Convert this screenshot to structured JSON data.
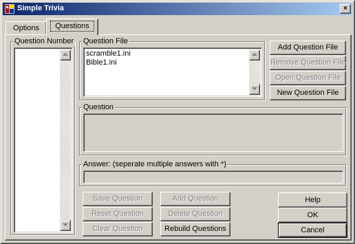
{
  "window": {
    "title": "Simple Trivia",
    "icon": "trivia-app-icon",
    "close_label": "×"
  },
  "tabs": [
    {
      "label": "Options",
      "selected": false
    },
    {
      "label": "Questions",
      "selected": true
    }
  ],
  "question_number": {
    "label": "Question Number",
    "items": []
  },
  "question_file": {
    "label": "Question File",
    "items": [
      "scramble1.ini",
      "Bible1.ini"
    ]
  },
  "file_buttons": {
    "add": "Add Question File",
    "remove": "Remove Question File",
    "open": "Open Question File",
    "new": "New Question File"
  },
  "question": {
    "label": "Question",
    "value": ""
  },
  "answer": {
    "label": "Answer:  (seperate multiple answers with *)",
    "value": ""
  },
  "question_buttons": {
    "save": "Save Question",
    "reset": "Reset Question",
    "clear": "Clear Question",
    "add": "Add Question",
    "delete": "Delete Question",
    "rebuild": "Rebuild Questions"
  },
  "dialog_buttons": {
    "help": "Help",
    "ok": "OK",
    "cancel": "Cancel"
  },
  "colors": {
    "face": "#d4d0c8",
    "title_start": "#0a246a",
    "title_end": "#a6caf0",
    "disabled_text": "#808080"
  }
}
